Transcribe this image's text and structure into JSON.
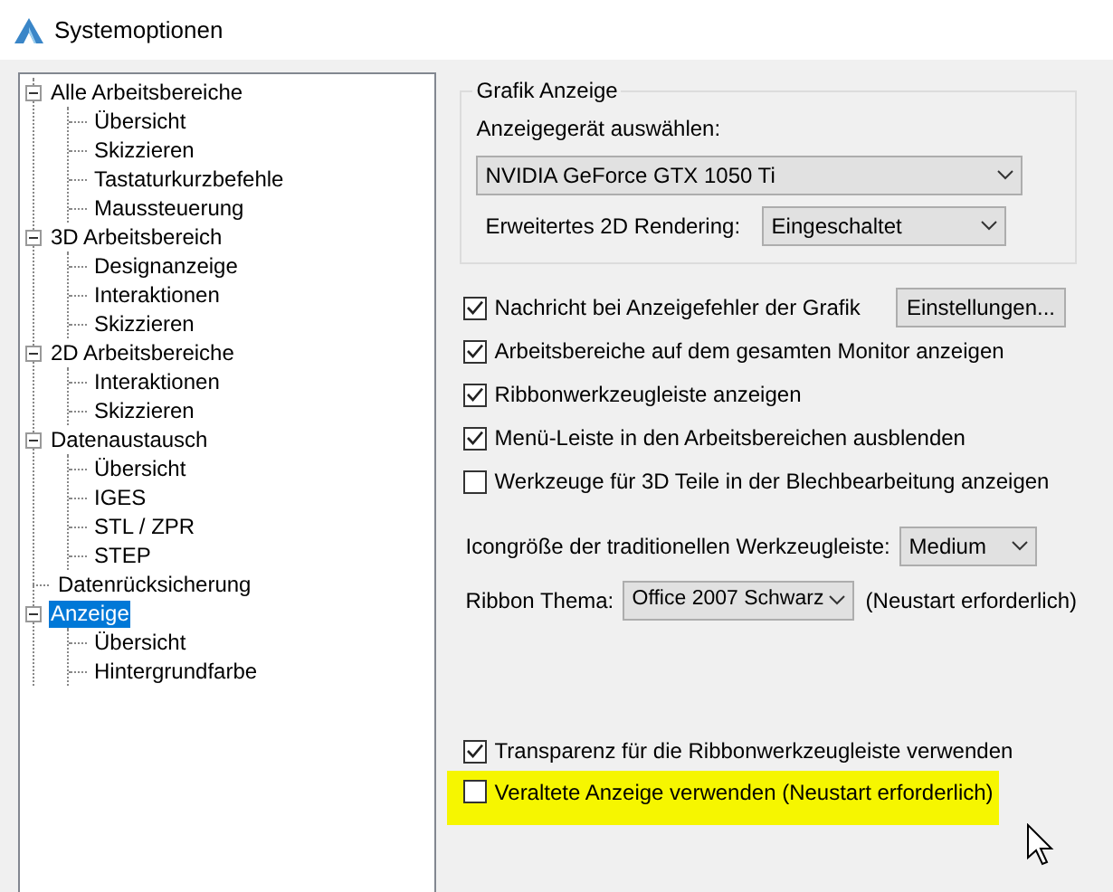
{
  "window": {
    "title": "Systemoptionen"
  },
  "tree": [
    {
      "label": "Alle Arbeitsbereiche",
      "selected": false,
      "expanded": true,
      "children": [
        {
          "label": "Übersicht",
          "selected": false
        },
        {
          "label": "Skizzieren",
          "selected": false
        },
        {
          "label": "Tastaturkurzbefehle",
          "selected": false
        },
        {
          "label": "Maussteuerung",
          "selected": false
        }
      ]
    },
    {
      "label": "3D Arbeitsbereich",
      "selected": false,
      "expanded": true,
      "children": [
        {
          "label": "Designanzeige",
          "selected": false
        },
        {
          "label": "Interaktionen",
          "selected": false
        },
        {
          "label": "Skizzieren",
          "selected": false
        }
      ]
    },
    {
      "label": "2D Arbeitsbereiche",
      "selected": false,
      "expanded": true,
      "children": [
        {
          "label": "Interaktionen",
          "selected": false
        },
        {
          "label": "Skizzieren",
          "selected": false
        }
      ]
    },
    {
      "label": "Datenaustausch",
      "selected": false,
      "expanded": true,
      "children": [
        {
          "label": "Übersicht",
          "selected": false
        },
        {
          "label": "IGES",
          "selected": false
        },
        {
          "label": "STL / ZPR",
          "selected": false
        },
        {
          "label": "STEP",
          "selected": false
        }
      ]
    },
    {
      "label": "Datenrücksicherung",
      "selected": false
    },
    {
      "label": "Anzeige",
      "selected": true,
      "expanded": true,
      "children": [
        {
          "label": "Übersicht",
          "selected": false
        },
        {
          "label": "Hintergrundfarbe",
          "selected": false
        }
      ]
    }
  ],
  "graphics_group": {
    "title": "Grafik Anzeige",
    "device_label": "Anzeigegerät auswählen:",
    "device": "NVIDIA GeForce GTX 1050 Ti",
    "rendering_label": "Erweitertes 2D Rendering:",
    "rendering": "Eingeschaltet"
  },
  "options": [
    {
      "label": "Nachricht bei Anzeigefehler der Grafik",
      "checked": true,
      "button": "Einstellungen..."
    },
    {
      "label": "Arbeitsbereiche auf dem gesamten Monitor anzeigen",
      "checked": true
    },
    {
      "label": "Ribbonwerkzeugleiste anzeigen",
      "checked": true
    },
    {
      "label": "Menü-Leiste in den Arbeitsbereichen ausblenden",
      "checked": true
    },
    {
      "label": "Werkzeuge für 3D Teile in der Blechbearbeitung anzeigen",
      "checked": false
    }
  ],
  "icon_size": {
    "label": "Icongröße der traditionellen Werkzeugleiste:",
    "value": "Medium"
  },
  "ribbon_theme": {
    "label": "Ribbon Thema:",
    "value": "Office 2007 Schwarz",
    "note": "(Neustart erforderlich)"
  },
  "bottom_options": [
    {
      "label": "Transparenz für die Ribbonwerkzeugleiste verwenden",
      "checked": true,
      "highlighted": false
    },
    {
      "label": "Veraltete Anzeige verwenden (Neustart erforderlich)",
      "checked": false,
      "highlighted": true
    }
  ]
}
